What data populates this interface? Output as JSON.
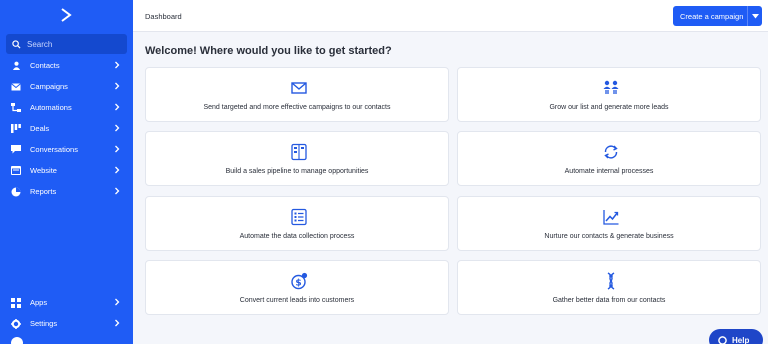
{
  "sidebar": {
    "logo_icon": "chevron-logo",
    "search_label": "Search",
    "items": [
      {
        "label": "Contacts",
        "icon": "person-icon"
      },
      {
        "label": "Campaigns",
        "icon": "mail-icon"
      },
      {
        "label": "Automations",
        "icon": "automation-icon"
      },
      {
        "label": "Deals",
        "icon": "deals-icon"
      },
      {
        "label": "Conversations",
        "icon": "chat-icon"
      },
      {
        "label": "Website",
        "icon": "website-icon"
      },
      {
        "label": "Reports",
        "icon": "pie-chart-icon"
      }
    ],
    "bottom_items": [
      {
        "label": "Apps",
        "icon": "apps-icon"
      },
      {
        "label": "Settings",
        "icon": "gear-icon"
      }
    ]
  },
  "topbar": {
    "breadcrumb": "Dashboard",
    "create_label": "Create a campaign"
  },
  "main": {
    "welcome": "Welcome! Where would you like to get started?",
    "cards": [
      {
        "label": "Send targeted and more effective campaigns to our contacts",
        "icon": "envelope-icon"
      },
      {
        "label": "Grow our list and generate more leads",
        "icon": "people-icon"
      },
      {
        "label": "Build a sales pipeline to manage opportunities",
        "icon": "pipeline-icon"
      },
      {
        "label": "Automate internal processes",
        "icon": "sync-icon"
      },
      {
        "label": "Automate the data collection process",
        "icon": "form-icon"
      },
      {
        "label": "Nurture our contacts & generate business",
        "icon": "growth-chart-icon"
      },
      {
        "label": "Convert current leads into customers",
        "icon": "dollar-icon"
      },
      {
        "label": "Gather better data from our contacts",
        "icon": "dna-icon"
      }
    ]
  },
  "help_label": "Help",
  "colors": {
    "brand": "#1f5cf5",
    "help": "#1f46c8",
    "background": "#f4f6fb"
  }
}
